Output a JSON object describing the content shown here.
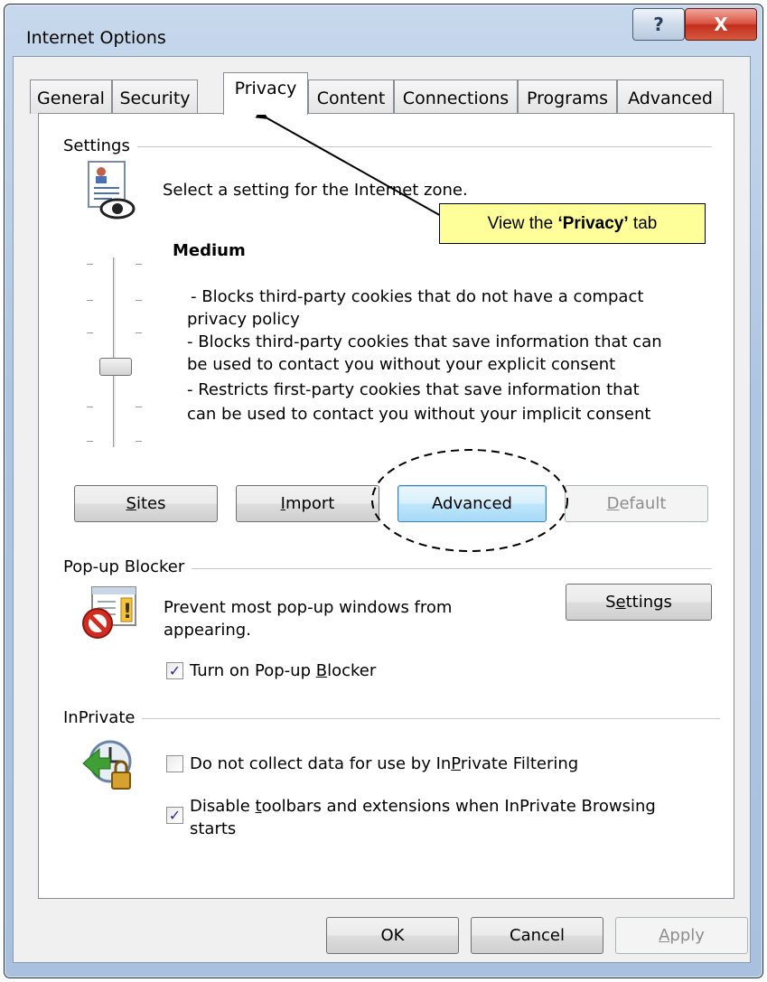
{
  "window": {
    "title": "Internet Options",
    "help_label": "?",
    "close_label": "X"
  },
  "tabs": [
    {
      "label": "General"
    },
    {
      "label": "Security"
    },
    {
      "label": "Privacy"
    },
    {
      "label": "Content"
    },
    {
      "label": "Connections"
    },
    {
      "label": "Programs"
    },
    {
      "label": "Advanced"
    }
  ],
  "active_tab": "Privacy",
  "settings": {
    "group_label": "Settings",
    "instruction": "Select a setting for the Internet zone.",
    "level": "Medium",
    "description": [
      "- Blocks third-party cookies that do not have a compact",
      "privacy policy",
      "- Blocks third-party cookies that save information that can",
      "be used to contact you without your explicit consent",
      "- Restricts first-party cookies that save information that",
      "can be used to contact you without your implicit consent"
    ],
    "buttons": {
      "sites": {
        "pre": "",
        "key": "S",
        "post": "ites"
      },
      "import": {
        "pre": "",
        "key": "I",
        "post": "mport"
      },
      "advanced": "Advanced",
      "default": {
        "pre": "",
        "key": "D",
        "post": "efault"
      }
    }
  },
  "popup_blocker": {
    "group_label": "Pop-up Blocker",
    "description": [
      "Prevent most pop-up windows from",
      "appearing."
    ],
    "settings_button": {
      "pre": "S",
      "key": "e",
      "post": "ttings"
    },
    "checkbox": {
      "pre": "Turn on Pop-up ",
      "key": "B",
      "post": "locker",
      "checked": true
    }
  },
  "inprivate": {
    "group_label": "InPrivate",
    "filtering": {
      "pre": "Do not collect data for use by In",
      "key": "P",
      "post": "rivate Filtering",
      "checked": false
    },
    "disable_toolbars": {
      "pre": "Disable ",
      "key": "t",
      "post": "oolbars and extensions when InPrivate Browsing",
      "line2": "starts",
      "checked": true
    }
  },
  "footer": {
    "ok": "OK",
    "cancel": "Cancel",
    "apply": {
      "pre": "",
      "key": "A",
      "post": "pply"
    }
  },
  "annotation": {
    "pre": "View the ",
    "emph": "‘Privacy’",
    "post": " tab"
  },
  "colors": {
    "callout_bg": "#ffff99",
    "focus_border": "#3c7fb1",
    "close_red": "#c22e1b"
  }
}
